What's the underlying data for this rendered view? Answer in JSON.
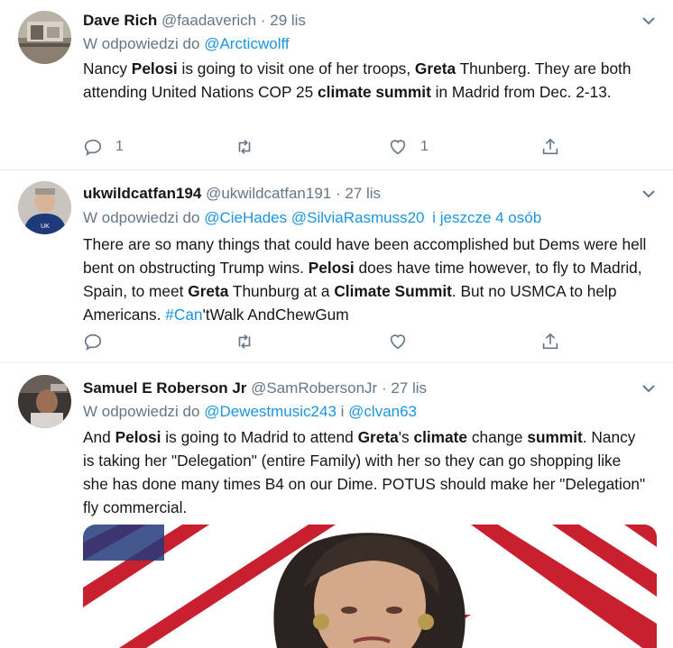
{
  "tweets": [
    {
      "name": "Dave Rich",
      "handle": "@faadaverich",
      "dot": "·",
      "time": "29 lis",
      "reply_prefix": "W odpowiedzi do",
      "reply_to": [
        "@Arcticwolff"
      ],
      "reply_suffix": "",
      "segments": [
        {
          "t": "Nancy ",
          "b": false
        },
        {
          "t": "Pelosi",
          "b": true
        },
        {
          "t": " is going to visit one of her troops, ",
          "b": false
        },
        {
          "t": "Greta",
          "b": true
        },
        {
          "t": " Thunberg.  They are both attending United Nations COP 25 ",
          "b": false
        },
        {
          "t": "climate summit",
          "b": true
        },
        {
          "t": " in Madrid from Dec. 2-13.",
          "b": false
        }
      ],
      "counts": {
        "reply": "1",
        "retweet": "",
        "like": "1"
      }
    },
    {
      "name": "ukwildcatfan194",
      "handle": "@ukwildcatfan191",
      "dot": "·",
      "time": "27 lis",
      "reply_prefix": "W odpowiedzi do",
      "reply_to": [
        "@CieHades",
        "@SilviaRasmuss20"
      ],
      "reply_suffix": "i jeszcze 4 osób",
      "segments": [
        {
          "t": "There are so many things that could have been accomplished but Dems were hell bent on obstructing Trump wins. ",
          "b": false
        },
        {
          "t": "Pelosi",
          "b": true
        },
        {
          "t": " does have time however, to fly to Madrid, Spain, to meet ",
          "b": false
        },
        {
          "t": "Greta",
          "b": true
        },
        {
          "t": " Thunburg at a ",
          "b": false
        },
        {
          "t": "Climate Summit",
          "b": true
        },
        {
          "t": ". But no USMCA to help Americans. ",
          "b": false
        },
        {
          "t": "#Can",
          "b": false,
          "link": true
        },
        {
          "t": "'tWalk AndChewGum",
          "b": false
        }
      ],
      "counts": {
        "reply": "",
        "retweet": "",
        "like": ""
      }
    },
    {
      "name": "Samuel E Roberson Jr",
      "handle": "@SamRobersonJr",
      "dot": "·",
      "time": "27 lis",
      "reply_prefix": "W odpowiedzi do",
      "reply_to": [
        "@Dewestmusic243",
        "@clvan63"
      ],
      "reply_join": "i",
      "reply_suffix": "",
      "segments": [
        {
          "t": "And ",
          "b": false
        },
        {
          "t": "Pelosi",
          "b": true
        },
        {
          "t": " is going to Madrid to attend ",
          "b": false
        },
        {
          "t": "Greta",
          "b": true
        },
        {
          "t": "'s ",
          "b": false
        },
        {
          "t": "climate",
          "b": true
        },
        {
          "t": " change ",
          "b": false
        },
        {
          "t": "summit",
          "b": true
        },
        {
          "t": ". Nancy is taking her \"Delegation\" (entire Family) with her so they can go shopping like she has done many times B4 on our Dime. POTUS should make her \"Delegation\" fly commercial.",
          "b": false
        }
      ],
      "counts": {
        "reply": "",
        "retweet": "",
        "like": ""
      }
    }
  ],
  "colors": {
    "link": "#1b95e0",
    "muted": "#657786",
    "text": "#14171a",
    "divider": "#e6ecf0"
  },
  "icons": [
    "reply-icon",
    "retweet-icon",
    "like-icon",
    "share-icon",
    "chevron-down-icon"
  ]
}
